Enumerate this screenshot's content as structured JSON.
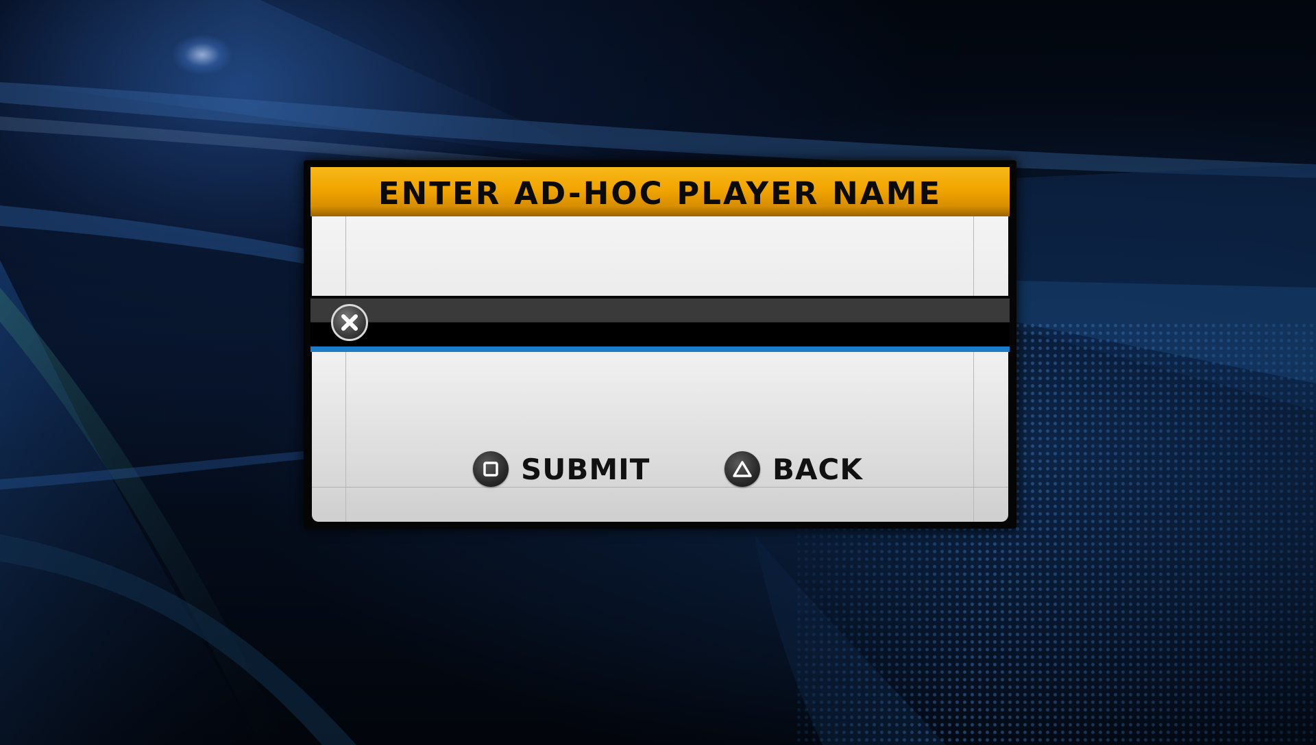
{
  "dialog": {
    "title": "ENTER AD-HOC PLAYER NAME",
    "input": {
      "value": "",
      "clear_icon": "cross-icon"
    },
    "actions": [
      {
        "label": "SUBMIT",
        "icon": "square-button-icon"
      },
      {
        "label": "BACK",
        "icon": "triangle-button-icon"
      }
    ]
  },
  "colors": {
    "title_bar": "#f2a500",
    "input_underline": "#1c7cc8",
    "panel": "#ececec"
  }
}
